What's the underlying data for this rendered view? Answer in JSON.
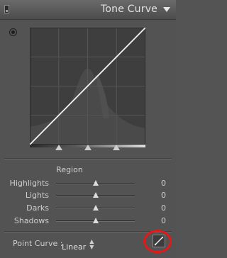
{
  "header": {
    "title": "Tone Curve"
  },
  "region": {
    "title": "Region",
    "sliders": [
      {
        "label": "Highlights",
        "value": "0",
        "level": 0.5
      },
      {
        "label": "Lights",
        "value": "0",
        "level": 0.5
      },
      {
        "label": "Darks",
        "value": "0",
        "level": 0.5
      },
      {
        "label": "Shadows",
        "value": "0",
        "level": 0.5
      }
    ]
  },
  "split_points": [
    0.25,
    0.5,
    0.75
  ],
  "point_curve": {
    "label": "Point Curve :",
    "selected": "Linear"
  },
  "icons": {
    "target": "target-adjustment-icon",
    "collapse": "triangle-down-icon",
    "edit_curve": "point-curve-edit-icon"
  },
  "colors": {
    "highlight": "#e41818"
  }
}
